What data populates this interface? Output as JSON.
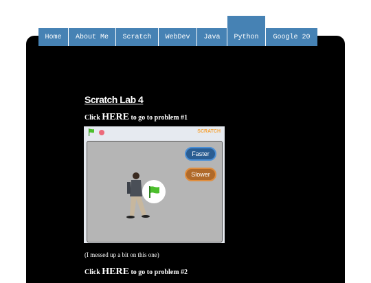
{
  "nav": {
    "items": [
      {
        "label": "Home"
      },
      {
        "label": "About Me"
      },
      {
        "label": "Scratch"
      },
      {
        "label": "WebDev"
      },
      {
        "label": "Java"
      },
      {
        "label": "Python",
        "active": true
      },
      {
        "label": "Google 20"
      }
    ]
  },
  "content": {
    "title": "Scratch Lab 4",
    "problem1": {
      "prefix": "Click ",
      "link": "HERE",
      "suffix": " to go to problem #1"
    },
    "note": "(I messed up a bit on this one)",
    "problem2": {
      "prefix": "Click ",
      "link": "HERE",
      "suffix": " to go to problem #2"
    }
  },
  "player": {
    "logo": "SCRATCH",
    "buttons": {
      "faster": "Faster",
      "slower": "Slower"
    }
  },
  "colors": {
    "nav": "#4682b4",
    "page_bg": "#000000",
    "faster": "#2a5d92",
    "slower": "#b06a2a"
  },
  "icons": [
    "green-flag-icon",
    "stop-icon"
  ]
}
